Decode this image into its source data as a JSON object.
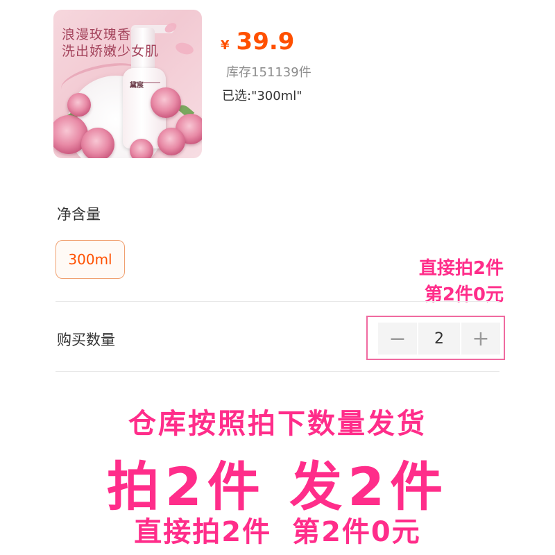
{
  "product": {
    "image_tagline_1": "浪漫玫瑰香",
    "image_tagline_2": "洗出娇嫩少女肌",
    "bottle_brand": "黛宸",
    "currency": "¥",
    "price": "39.9",
    "stock": "库存151139件",
    "selected": "已选:\"300ml\""
  },
  "spec": {
    "title": "净含量",
    "options": [
      {
        "label": "300ml",
        "selected": true
      }
    ]
  },
  "quantity": {
    "label": "购买数量",
    "decrement": "−",
    "value": "2",
    "increment": "+"
  },
  "promo_right": {
    "line1": "直接拍2件",
    "line2": "第2件0元"
  },
  "bottom_promo": {
    "line1": "仓库按照拍下数量发货",
    "line2": "拍2件 发2件",
    "line3a": "直接拍2件",
    "line3b": "第2件0元"
  },
  "colors": {
    "price": "#ff5000",
    "promo": "#ff2d8a",
    "option_border": "#f0a070",
    "highlight_box": "#f06aa0"
  }
}
